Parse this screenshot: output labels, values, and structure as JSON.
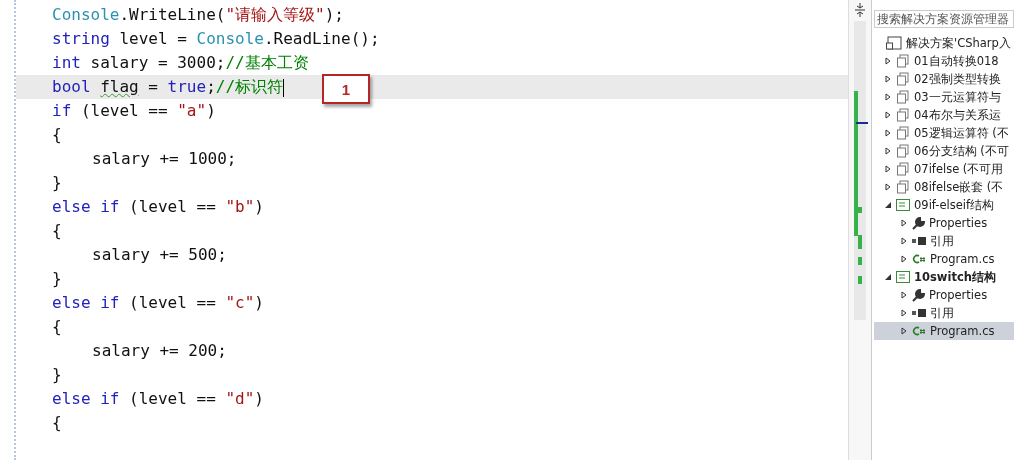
{
  "editor": {
    "lines": [
      {
        "indented": false,
        "current": false,
        "cursor": false,
        "tokens": [
          {
            "kind": "type",
            "text": "Console"
          },
          {
            "kind": "plain",
            "text": ".WriteLine("
          },
          {
            "kind": "string",
            "text": "\"请输入等级\""
          },
          {
            "kind": "plain",
            "text": ");"
          }
        ]
      },
      {
        "indented": false,
        "current": false,
        "cursor": false,
        "tokens": [
          {
            "kind": "keyword",
            "text": "string"
          },
          {
            "kind": "plain",
            "text": " level = "
          },
          {
            "kind": "type",
            "text": "Console"
          },
          {
            "kind": "plain",
            "text": ".ReadLine();"
          }
        ]
      },
      {
        "indented": false,
        "current": false,
        "cursor": false,
        "tokens": [
          {
            "kind": "keyword",
            "text": "int"
          },
          {
            "kind": "plain",
            "text": " salary = 3000;"
          },
          {
            "kind": "comment",
            "text": "//基本工资"
          }
        ]
      },
      {
        "indented": false,
        "current": true,
        "cursor": true,
        "tokens": [
          {
            "kind": "keyword",
            "text": "bool"
          },
          {
            "kind": "warning",
            "text": "flag",
            "space_before": true
          },
          {
            "kind": "plain",
            "text": " = "
          },
          {
            "kind": "keyword",
            "text": "true"
          },
          {
            "kind": "plain",
            "text": ";"
          },
          {
            "kind": "comment",
            "text": "//标识符"
          }
        ]
      },
      {
        "indented": false,
        "current": false,
        "cursor": false,
        "tokens": [
          {
            "kind": "keyword",
            "text": "if"
          },
          {
            "kind": "plain",
            "text": " (level == "
          },
          {
            "kind": "string",
            "text": "\"a\""
          },
          {
            "kind": "plain",
            "text": ")"
          }
        ]
      },
      {
        "indented": false,
        "current": false,
        "cursor": false,
        "tokens": [
          {
            "kind": "plain",
            "text": "{"
          }
        ]
      },
      {
        "indented": true,
        "current": false,
        "cursor": false,
        "tokens": [
          {
            "kind": "plain",
            "text": "salary += 1000;"
          }
        ]
      },
      {
        "indented": false,
        "current": false,
        "cursor": false,
        "tokens": [
          {
            "kind": "plain",
            "text": "}"
          }
        ]
      },
      {
        "indented": false,
        "current": false,
        "cursor": false,
        "tokens": [
          {
            "kind": "keyword",
            "text": "else if"
          },
          {
            "kind": "plain",
            "text": " (level == "
          },
          {
            "kind": "string",
            "text": "\"b\""
          },
          {
            "kind": "plain",
            "text": ")"
          }
        ]
      },
      {
        "indented": false,
        "current": false,
        "cursor": false,
        "tokens": [
          {
            "kind": "plain",
            "text": "{"
          }
        ]
      },
      {
        "indented": true,
        "current": false,
        "cursor": false,
        "tokens": [
          {
            "kind": "plain",
            "text": "salary += 500;"
          }
        ]
      },
      {
        "indented": false,
        "current": false,
        "cursor": false,
        "tokens": [
          {
            "kind": "plain",
            "text": "}"
          }
        ]
      },
      {
        "indented": false,
        "current": false,
        "cursor": false,
        "tokens": [
          {
            "kind": "keyword",
            "text": "else if"
          },
          {
            "kind": "plain",
            "text": " (level == "
          },
          {
            "kind": "string",
            "text": "\"c\""
          },
          {
            "kind": "plain",
            "text": ")"
          }
        ]
      },
      {
        "indented": false,
        "current": false,
        "cursor": false,
        "tokens": [
          {
            "kind": "plain",
            "text": "{"
          }
        ]
      },
      {
        "indented": true,
        "current": false,
        "cursor": false,
        "tokens": [
          {
            "kind": "plain",
            "text": "salary += 200;"
          }
        ]
      },
      {
        "indented": false,
        "current": false,
        "cursor": false,
        "tokens": [
          {
            "kind": "plain",
            "text": "}"
          }
        ]
      },
      {
        "indented": false,
        "current": false,
        "cursor": false,
        "tokens": [
          {
            "kind": "keyword",
            "text": "else if"
          },
          {
            "kind": "plain",
            "text": " (level == "
          },
          {
            "kind": "string",
            "text": "\"d\""
          },
          {
            "kind": "plain",
            "text": ")"
          }
        ]
      },
      {
        "indented": false,
        "current": false,
        "cursor": false,
        "tokens": [
          {
            "kind": "plain",
            "text": "{"
          }
        ]
      }
    ],
    "callout": "1"
  },
  "solution_explorer": {
    "search": {
      "placeholder": "搜索解决方案资源管理器"
    },
    "solution": {
      "label": "解决方案'CSharp入",
      "kind": "solution"
    },
    "items": [
      {
        "label": "01自动转换018",
        "kind": "folder",
        "expanded": false,
        "startup": false,
        "selected": false
      },
      {
        "label": "02强制类型转换",
        "kind": "folder",
        "expanded": false,
        "startup": false,
        "selected": false
      },
      {
        "label": "03一元运算符与",
        "kind": "folder",
        "expanded": false,
        "startup": false,
        "selected": false
      },
      {
        "label": "04布尔与关系运",
        "kind": "folder",
        "expanded": false,
        "startup": false,
        "selected": false
      },
      {
        "label": "05逻辑运算符 (不",
        "kind": "folder",
        "expanded": false,
        "startup": false,
        "selected": false
      },
      {
        "label": "06分支结构 (不可",
        "kind": "folder",
        "expanded": false,
        "startup": false,
        "selected": false
      },
      {
        "label": "07ifelse (不可用",
        "kind": "folder",
        "expanded": false,
        "startup": false,
        "selected": false
      },
      {
        "label": "08ifelse嵌套 (不",
        "kind": "folder",
        "expanded": false,
        "startup": false,
        "selected": false
      },
      {
        "label": "09if-elseif结构",
        "kind": "csproject",
        "expanded": true,
        "startup": false,
        "selected": false,
        "children": [
          {
            "label": "Properties",
            "kind": "properties",
            "expanded": false,
            "selected": false
          },
          {
            "label": "引用",
            "kind": "references",
            "expanded": false,
            "selected": false
          },
          {
            "label": "Program.cs",
            "kind": "csfile",
            "expanded": false,
            "selected": false
          }
        ]
      },
      {
        "label": "10switch结构",
        "kind": "csproject",
        "expanded": true,
        "startup": true,
        "selected": false,
        "children": [
          {
            "label": "Properties",
            "kind": "properties",
            "expanded": false,
            "selected": false
          },
          {
            "label": "引用",
            "kind": "references",
            "expanded": false,
            "selected": false
          },
          {
            "label": "Program.cs",
            "kind": "csfile",
            "expanded": false,
            "selected": true
          }
        ]
      }
    ]
  }
}
